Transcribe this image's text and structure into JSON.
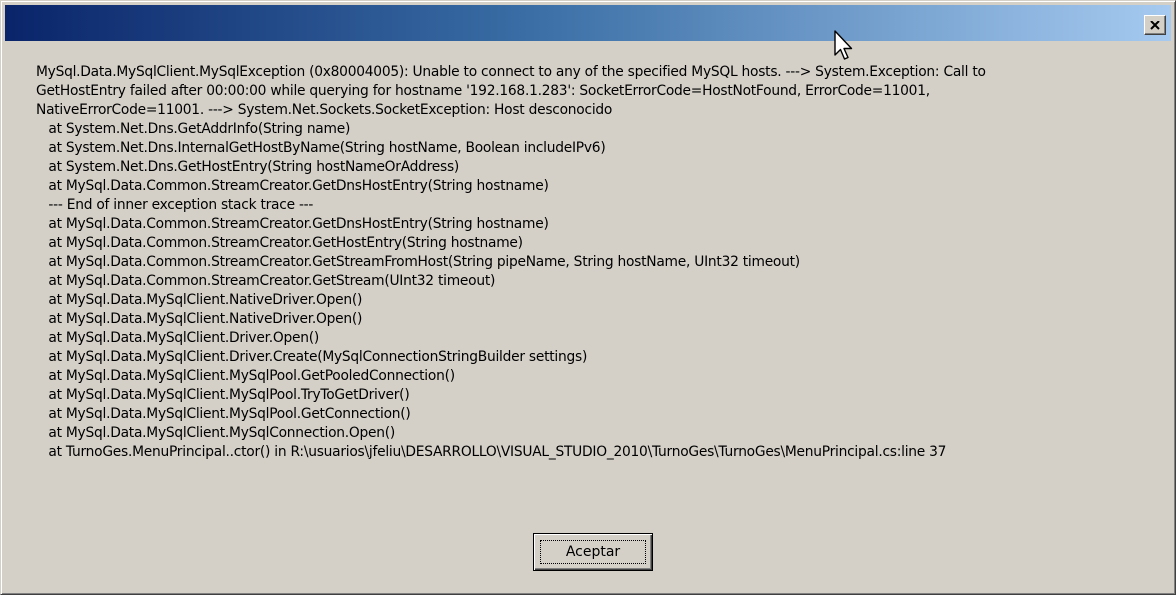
{
  "window": {
    "title": "",
    "close_glyph": "close-icon"
  },
  "message": {
    "lines": [
      "MySql.Data.MySqlClient.MySqlException (0x80004005): Unable to connect to any of the specified MySQL hosts. ---> System.Exception: Call to",
      "GetHostEntry failed after 00:00:00 while querying for hostname '192.168.1.283': SocketErrorCode=HostNotFound, ErrorCode=11001,",
      "NativeErrorCode=11001. ---> System.Net.Sockets.SocketException: Host desconocido",
      "   at System.Net.Dns.GetAddrInfo(String name)",
      "   at System.Net.Dns.InternalGetHostByName(String hostName, Boolean includeIPv6)",
      "   at System.Net.Dns.GetHostEntry(String hostNameOrAddress)",
      "   at MySql.Data.Common.StreamCreator.GetDnsHostEntry(String hostname)",
      "   --- End of inner exception stack trace ---",
      "   at MySql.Data.Common.StreamCreator.GetDnsHostEntry(String hostname)",
      "   at MySql.Data.Common.StreamCreator.GetHostEntry(String hostname)",
      "   at MySql.Data.Common.StreamCreator.GetStreamFromHost(String pipeName, String hostName, UInt32 timeout)",
      "   at MySql.Data.Common.StreamCreator.GetStream(UInt32 timeout)",
      "   at MySql.Data.MySqlClient.NativeDriver.Open()",
      "   at MySql.Data.MySqlClient.NativeDriver.Open()",
      "   at MySql.Data.MySqlClient.Driver.Open()",
      "   at MySql.Data.MySqlClient.Driver.Create(MySqlConnectionStringBuilder settings)",
      "   at MySql.Data.MySqlClient.MySqlPool.GetPooledConnection()",
      "   at MySql.Data.MySqlClient.MySqlPool.TryToGetDriver()",
      "   at MySql.Data.MySqlClient.MySqlPool.GetConnection()",
      "   at MySql.Data.MySqlClient.MySqlConnection.Open()",
      "   at TurnoGes.MenuPrincipal..ctor() in R:\\usuarios\\jfeliu\\DESARROLLO\\VISUAL_STUDIO_2010\\TurnoGes\\TurnoGes\\MenuPrincipal.cs:line 37"
    ]
  },
  "buttons": {
    "ok_label": "Aceptar"
  },
  "colors": {
    "titlebar_start": "#0a246a",
    "titlebar_end": "#a6caf0",
    "face": "#d4d0c8"
  },
  "icons": {
    "close": "close-icon",
    "cursor": "mouse-pointer-icon"
  }
}
